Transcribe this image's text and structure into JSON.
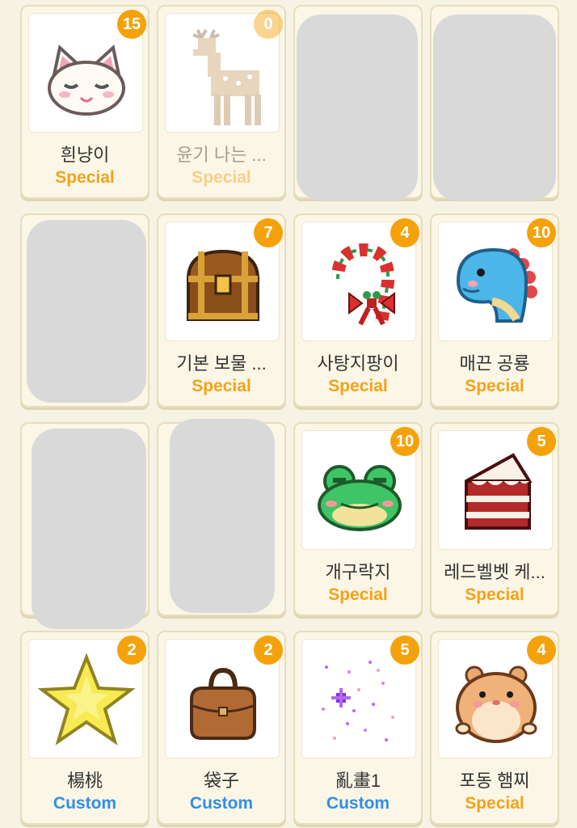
{
  "cards": [
    {
      "name": "흰냥이",
      "category": "Special",
      "count": "15",
      "icon": "white-cat-icon"
    },
    {
      "name": "윤기 나는 ...",
      "category": "Special",
      "count": "0",
      "icon": "deer-icon"
    },
    {
      "name": "기본 보물 ...",
      "category": "Special",
      "count": "7",
      "icon": "treasure-chest-icon"
    },
    {
      "name": "사탕지팡이",
      "category": "Special",
      "count": "4",
      "icon": "candy-cane-icon"
    },
    {
      "name": "매끈 공룡",
      "category": "Special",
      "count": "10",
      "icon": "blue-dinosaur-icon"
    },
    {
      "name": "개구락지",
      "category": "Special",
      "count": "10",
      "icon": "frog-icon"
    },
    {
      "name": "레드벨벳 케...",
      "category": "Special",
      "count": "5",
      "icon": "red-velvet-cake-icon"
    },
    {
      "name": "楊桃",
      "category": "Custom",
      "count": "2",
      "icon": "star-fruit-icon"
    },
    {
      "name": "袋子",
      "category": "Custom",
      "count": "2",
      "icon": "bag-icon"
    },
    {
      "name": "亂畫1",
      "category": "Custom",
      "count": "5",
      "icon": "sparkle-doodle-icon"
    },
    {
      "name": "포동 햄찌",
      "category": "Special",
      "count": "4",
      "icon": "hamster-icon"
    }
  ],
  "colors": {
    "special": "#f3a21a",
    "custom": "#2f8fe6",
    "badge": "#f5a20a"
  }
}
